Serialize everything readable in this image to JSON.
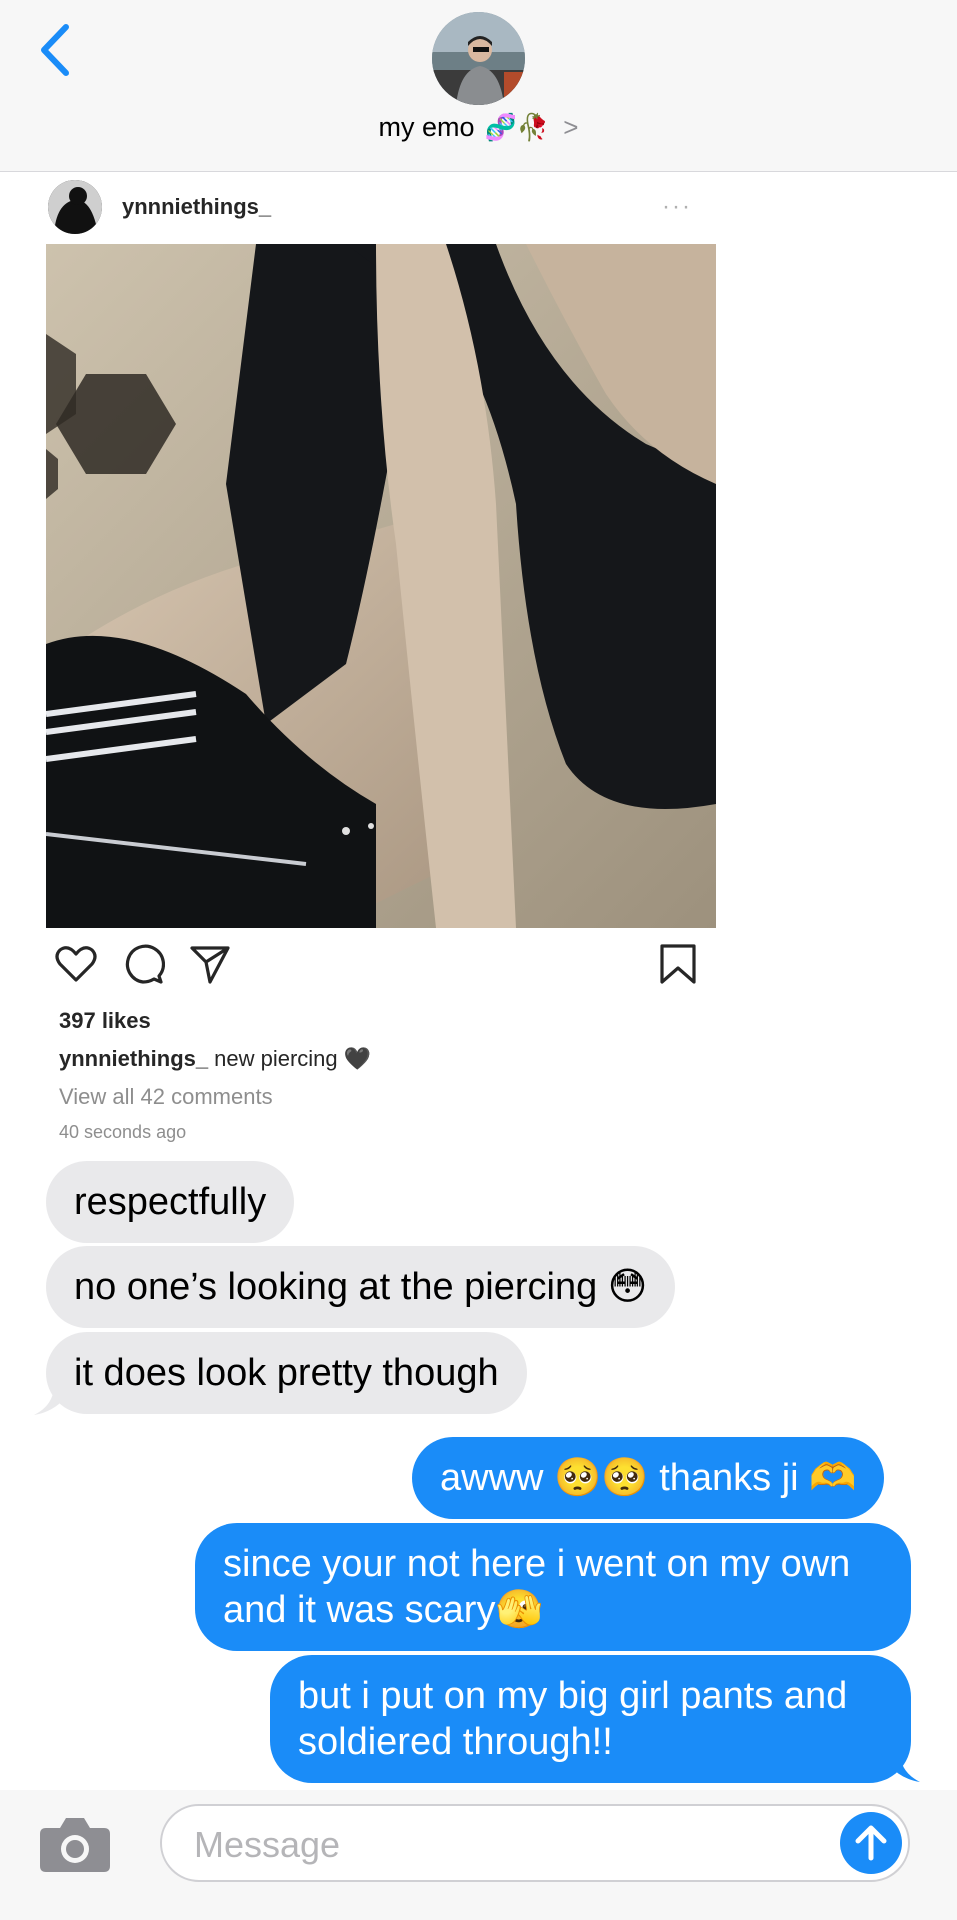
{
  "header": {
    "contact_name": "my emo",
    "contact_emoji": "🧬🥀",
    "chevron": ">",
    "back_icon": "chevron-left-icon",
    "accent": "#1a8cf8"
  },
  "shared_post": {
    "username": "ynnniethings_",
    "more": "···",
    "likes": "397 likes",
    "caption_user": "ynnniethings_",
    "caption_text": "new piercing 🖤",
    "view_comments": "View all 42 comments",
    "time": "40 seconds ago",
    "icons": [
      "heart-icon",
      "comment-icon",
      "share-icon",
      "bookmark-icon"
    ]
  },
  "messages": [
    {
      "direction": "incoming",
      "text": "respectfully"
    },
    {
      "direction": "incoming",
      "text": "no one’s looking at the piercing 😳"
    },
    {
      "direction": "incoming",
      "text": "it does look pretty though"
    },
    {
      "direction": "outgoing",
      "text": "awww 🥺🥺 thanks ji 🫶"
    },
    {
      "direction": "outgoing",
      "text": "since your not here i went on my own and it was scary🫣"
    },
    {
      "direction": "outgoing",
      "text": "but i put on my big girl pants and soldiered through!!"
    }
  ],
  "composer": {
    "placeholder": "Message",
    "camera_icon": "camera-icon",
    "send_icon": "send-arrow-icon"
  },
  "colors": {
    "incoming_bubble": "#e9e9eb",
    "outgoing_bubble": "#1a8cf8",
    "header_bg": "#f7f7f7"
  }
}
